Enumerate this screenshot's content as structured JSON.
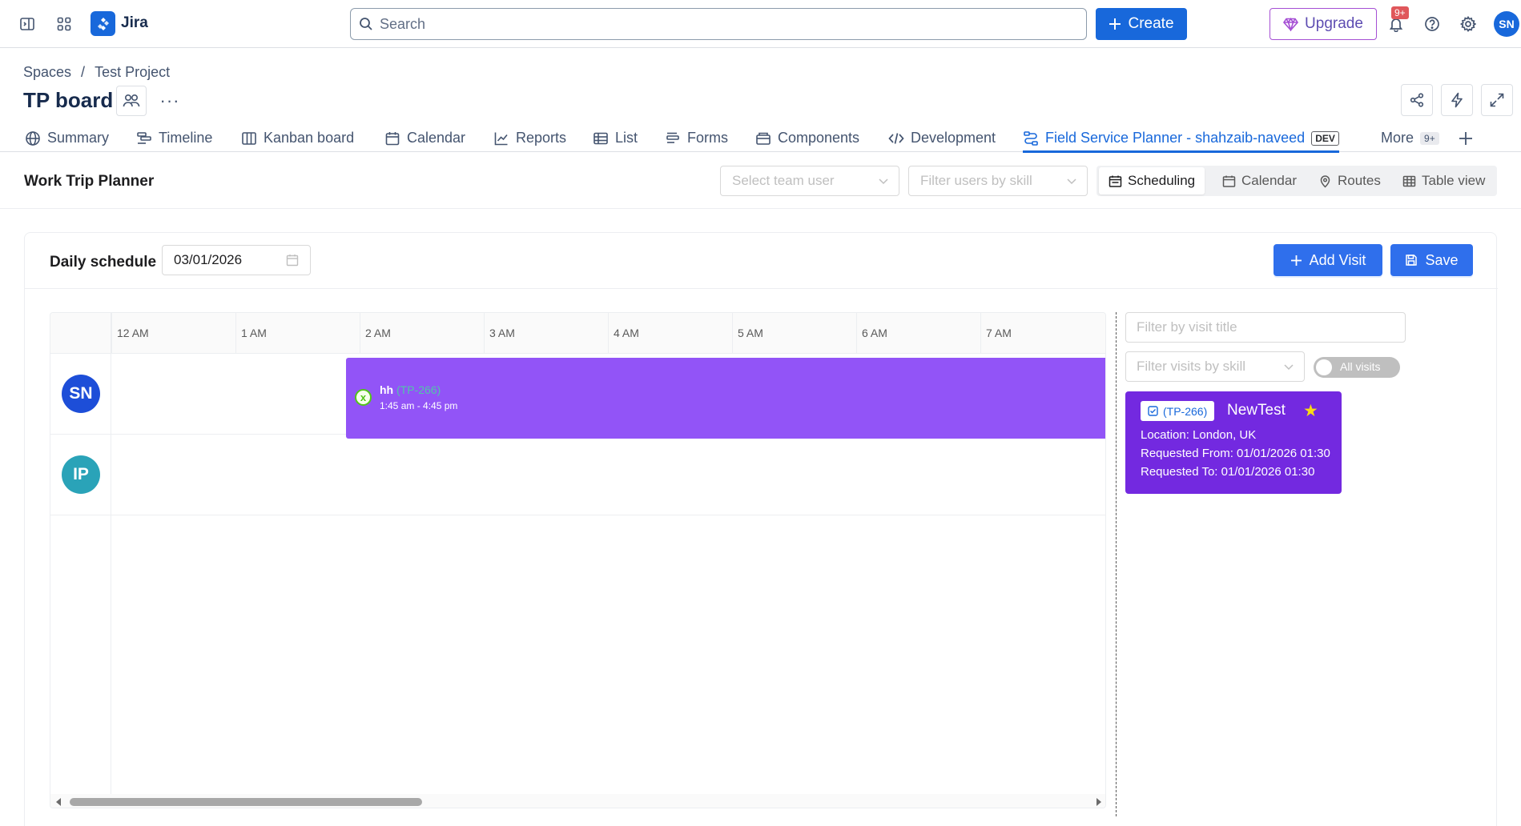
{
  "app": {
    "name": "Jira"
  },
  "search": {
    "placeholder": "Search"
  },
  "topnav": {
    "create_label": "Create",
    "upgrade_label": "Upgrade",
    "notification_count": "9+",
    "user_initials": "SN"
  },
  "breadcrumb": {
    "items": [
      "Spaces",
      "/",
      "Test Project"
    ]
  },
  "page": {
    "title": "TP board",
    "more_label": "···"
  },
  "tabs": [
    {
      "label": "Summary"
    },
    {
      "label": "Timeline"
    },
    {
      "label": "Kanban board"
    },
    {
      "label": "Calendar"
    },
    {
      "label": "Reports"
    },
    {
      "label": "List"
    },
    {
      "label": "Forms"
    },
    {
      "label": "Components"
    },
    {
      "label": "Development"
    },
    {
      "label": "Field Service Planner - shahzaib-naveed",
      "badge": "DEV",
      "active": true
    },
    {
      "label": "More",
      "badge": "9+"
    }
  ],
  "planner": {
    "title": "Work Trip Planner",
    "team_user_placeholder": "Select team user",
    "skill_placeholder": "Filter users by skill",
    "views": [
      {
        "label": "Scheduling",
        "active": true
      },
      {
        "label": "Calendar"
      },
      {
        "label": "Routes"
      },
      {
        "label": "Table view"
      }
    ]
  },
  "schedule": {
    "label": "Daily schedule",
    "date": "03/01/2026",
    "add_visit_label": "Add Visit",
    "save_label": "Save",
    "hours": [
      "12 AM",
      "1 AM",
      "2 AM",
      "3 AM",
      "4 AM",
      "5 AM",
      "6 AM",
      "7 AM"
    ],
    "rows": [
      {
        "initials": "SN",
        "color": "#1d4ed8"
      },
      {
        "initials": "IP",
        "color": "#2aa3b8"
      }
    ],
    "event": {
      "title": "hh",
      "key": "(TP-266)",
      "time": "1:45 am - 4:45 pm",
      "status_mark": "x"
    }
  },
  "visits_panel": {
    "title_filter_placeholder": "Filter by visit title",
    "skill_filter_placeholder": "Filter visits by skill",
    "toggle_label": "All visits",
    "card": {
      "key": "(TP-266)",
      "title": "NewTest",
      "location": "Location: London, UK",
      "requested_from": "Requested From: 01/01/2026 01:30",
      "requested_to": "Requested To: 01/01/2026 01:30"
    }
  },
  "colors": {
    "brand": "#1868db",
    "event": "#9254f7",
    "visit_card": "#7329e0",
    "primary_button": "#2f6fec"
  }
}
